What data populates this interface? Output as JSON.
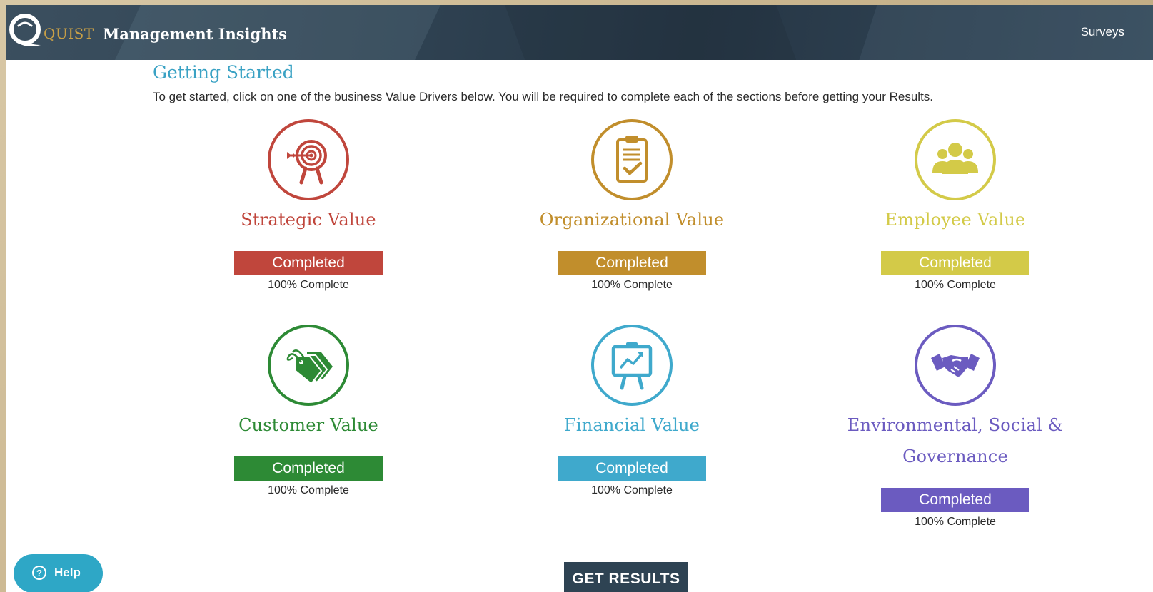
{
  "header": {
    "logo_text": "QUIST",
    "app_title": "Management Insights",
    "nav_surveys": "Surveys"
  },
  "intro": {
    "heading": "Getting Started",
    "text": "To get started, click on one of the business Value Drivers below. You will be required to complete each of the sections before getting your Results."
  },
  "drivers": [
    {
      "title": "Strategic Value",
      "status": "Completed",
      "progress_text": "100% Complete",
      "progress": 100,
      "color": "#c0463c",
      "icon": "target-icon"
    },
    {
      "title": "Organizational Value",
      "status": "Completed",
      "progress_text": "100% Complete",
      "progress": 100,
      "color": "#c18e2c",
      "icon": "clipboard-icon"
    },
    {
      "title": "Employee Value",
      "status": "Completed",
      "progress_text": "100% Complete",
      "progress": 100,
      "color": "#d3ca48",
      "icon": "people-icon"
    },
    {
      "title": "Customer Value",
      "status": "Completed",
      "progress_text": "100% Complete",
      "progress": 100,
      "color": "#2d8a35",
      "icon": "price-tags-icon"
    },
    {
      "title": "Financial Value",
      "status": "Completed",
      "progress_text": "100% Complete",
      "progress": 100,
      "color": "#3fa9cc",
      "icon": "presentation-board-icon"
    },
    {
      "title": "Environmental, Social & Governance",
      "status": "Completed",
      "progress_text": "100% Complete",
      "progress": 100,
      "color": "#6b5bc0",
      "icon": "handshake-icon"
    }
  ],
  "actions": {
    "get_results": "GET RESULTS",
    "help": "Help"
  }
}
